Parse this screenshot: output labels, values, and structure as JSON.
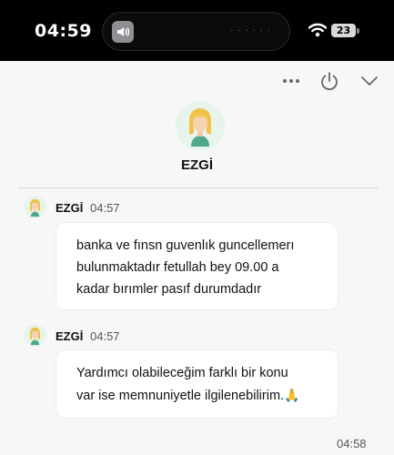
{
  "status_bar": {
    "time": "04:59",
    "battery": "23"
  },
  "header": {
    "agent_name": "EZGİ"
  },
  "messages": [
    {
      "sender": "EZGİ",
      "time": "04:57",
      "lines": [
        "banka ve fınsn guvenlık guncellemerı",
        "bulunmaktadır fetullah bey 09.00 a",
        "kadar bırımler pasıf durumdadır"
      ]
    },
    {
      "sender": "EZGİ",
      "time": "04:57",
      "lines": [
        "Yardımcı olabileceğim farklı bir konu",
        "var ise memnuniyetle ilgilenebilirim."
      ],
      "emoji": "🙏"
    }
  ],
  "footer": {
    "time": "04:58"
  },
  "colors": {
    "status_bar_bg": "#000000",
    "chat_bg": "#f7f7f7",
    "bubble_bg": "#ffffff",
    "avatar_bg": "#e6f4ec"
  },
  "icons": [
    "speaker-icon",
    "wifi-icon",
    "battery-icon",
    "more-icon",
    "power-icon",
    "chevron-down-icon",
    "agent-avatar",
    "folded-hands-emoji"
  ]
}
